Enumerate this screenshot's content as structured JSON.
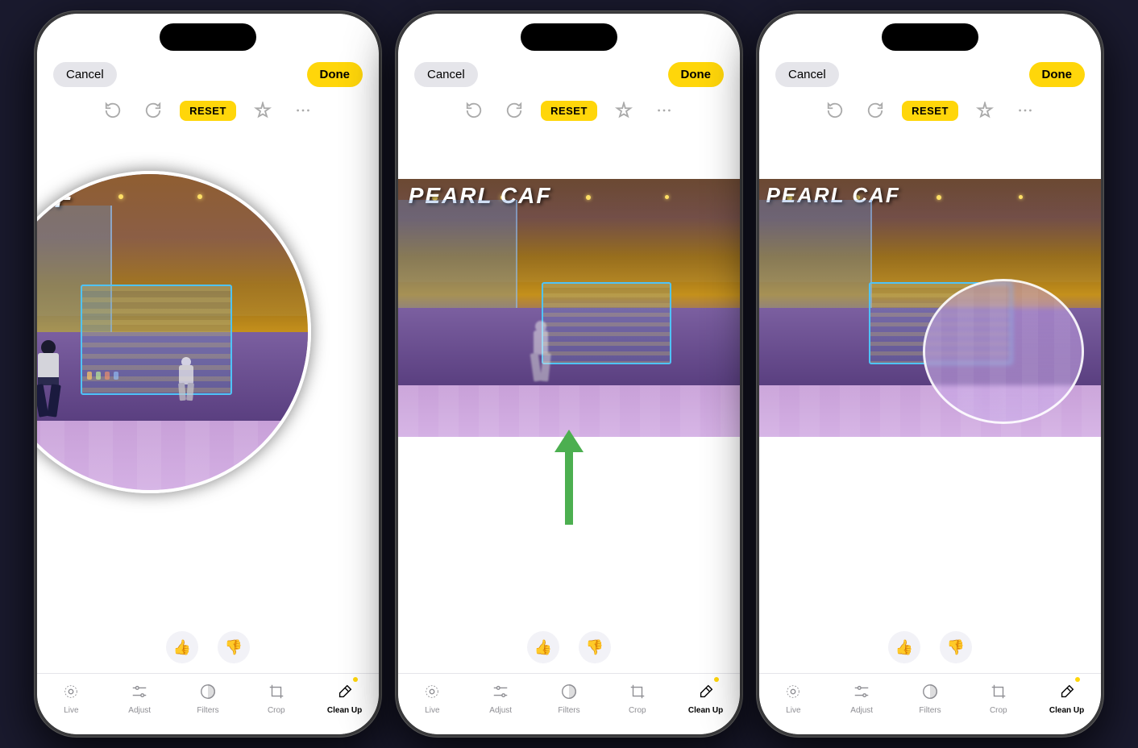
{
  "phones": [
    {
      "id": "phone1",
      "topbar": {
        "cancel": "Cancel",
        "done": "Done",
        "reset": "RESET"
      },
      "tools": [
        {
          "id": "live",
          "label": "Live",
          "icon": "circle-dot",
          "active": false
        },
        {
          "id": "adjust",
          "label": "Adjust",
          "icon": "sliders",
          "active": false
        },
        {
          "id": "filters",
          "label": "Filters",
          "icon": "circle-half",
          "active": false
        },
        {
          "id": "crop",
          "label": "Crop",
          "icon": "crop",
          "active": false
        },
        {
          "id": "cleanup",
          "label": "Clean Up",
          "icon": "wand",
          "active": true
        }
      ],
      "has_circle": true,
      "circle_type": "zoom",
      "has_arrow": false,
      "has_person": true,
      "cafe_sign": "CAF"
    },
    {
      "id": "phone2",
      "topbar": {
        "cancel": "Cancel",
        "done": "Done",
        "reset": "RESET"
      },
      "tools": [
        {
          "id": "live",
          "label": "Live",
          "icon": "circle-dot",
          "active": false
        },
        {
          "id": "adjust",
          "label": "Adjust",
          "icon": "sliders",
          "active": false
        },
        {
          "id": "filters",
          "label": "Filters",
          "icon": "circle-half",
          "active": false
        },
        {
          "id": "crop",
          "label": "Crop",
          "icon": "crop",
          "active": false
        },
        {
          "id": "cleanup",
          "label": "Clean Up",
          "icon": "wand",
          "active": true
        }
      ],
      "has_circle": false,
      "circle_type": "none",
      "has_arrow": true,
      "has_person": true,
      "cafe_sign": "PEARL CAF"
    },
    {
      "id": "phone3",
      "topbar": {
        "cancel": "Cancel",
        "done": "Done",
        "reset": "RESET"
      },
      "tools": [
        {
          "id": "live",
          "label": "Live",
          "icon": "circle-dot",
          "active": false
        },
        {
          "id": "adjust",
          "label": "Adjust",
          "icon": "sliders",
          "active": false
        },
        {
          "id": "filters",
          "label": "Filters",
          "icon": "circle-half",
          "active": false
        },
        {
          "id": "crop",
          "label": "Crop",
          "icon": "crop",
          "active": false
        },
        {
          "id": "cleanup",
          "label": "Clean Up",
          "icon": "wand",
          "active": true
        }
      ],
      "has_circle": true,
      "circle_type": "blur",
      "has_arrow": false,
      "has_person": false,
      "cafe_sign": "PEARL CAF"
    }
  ]
}
